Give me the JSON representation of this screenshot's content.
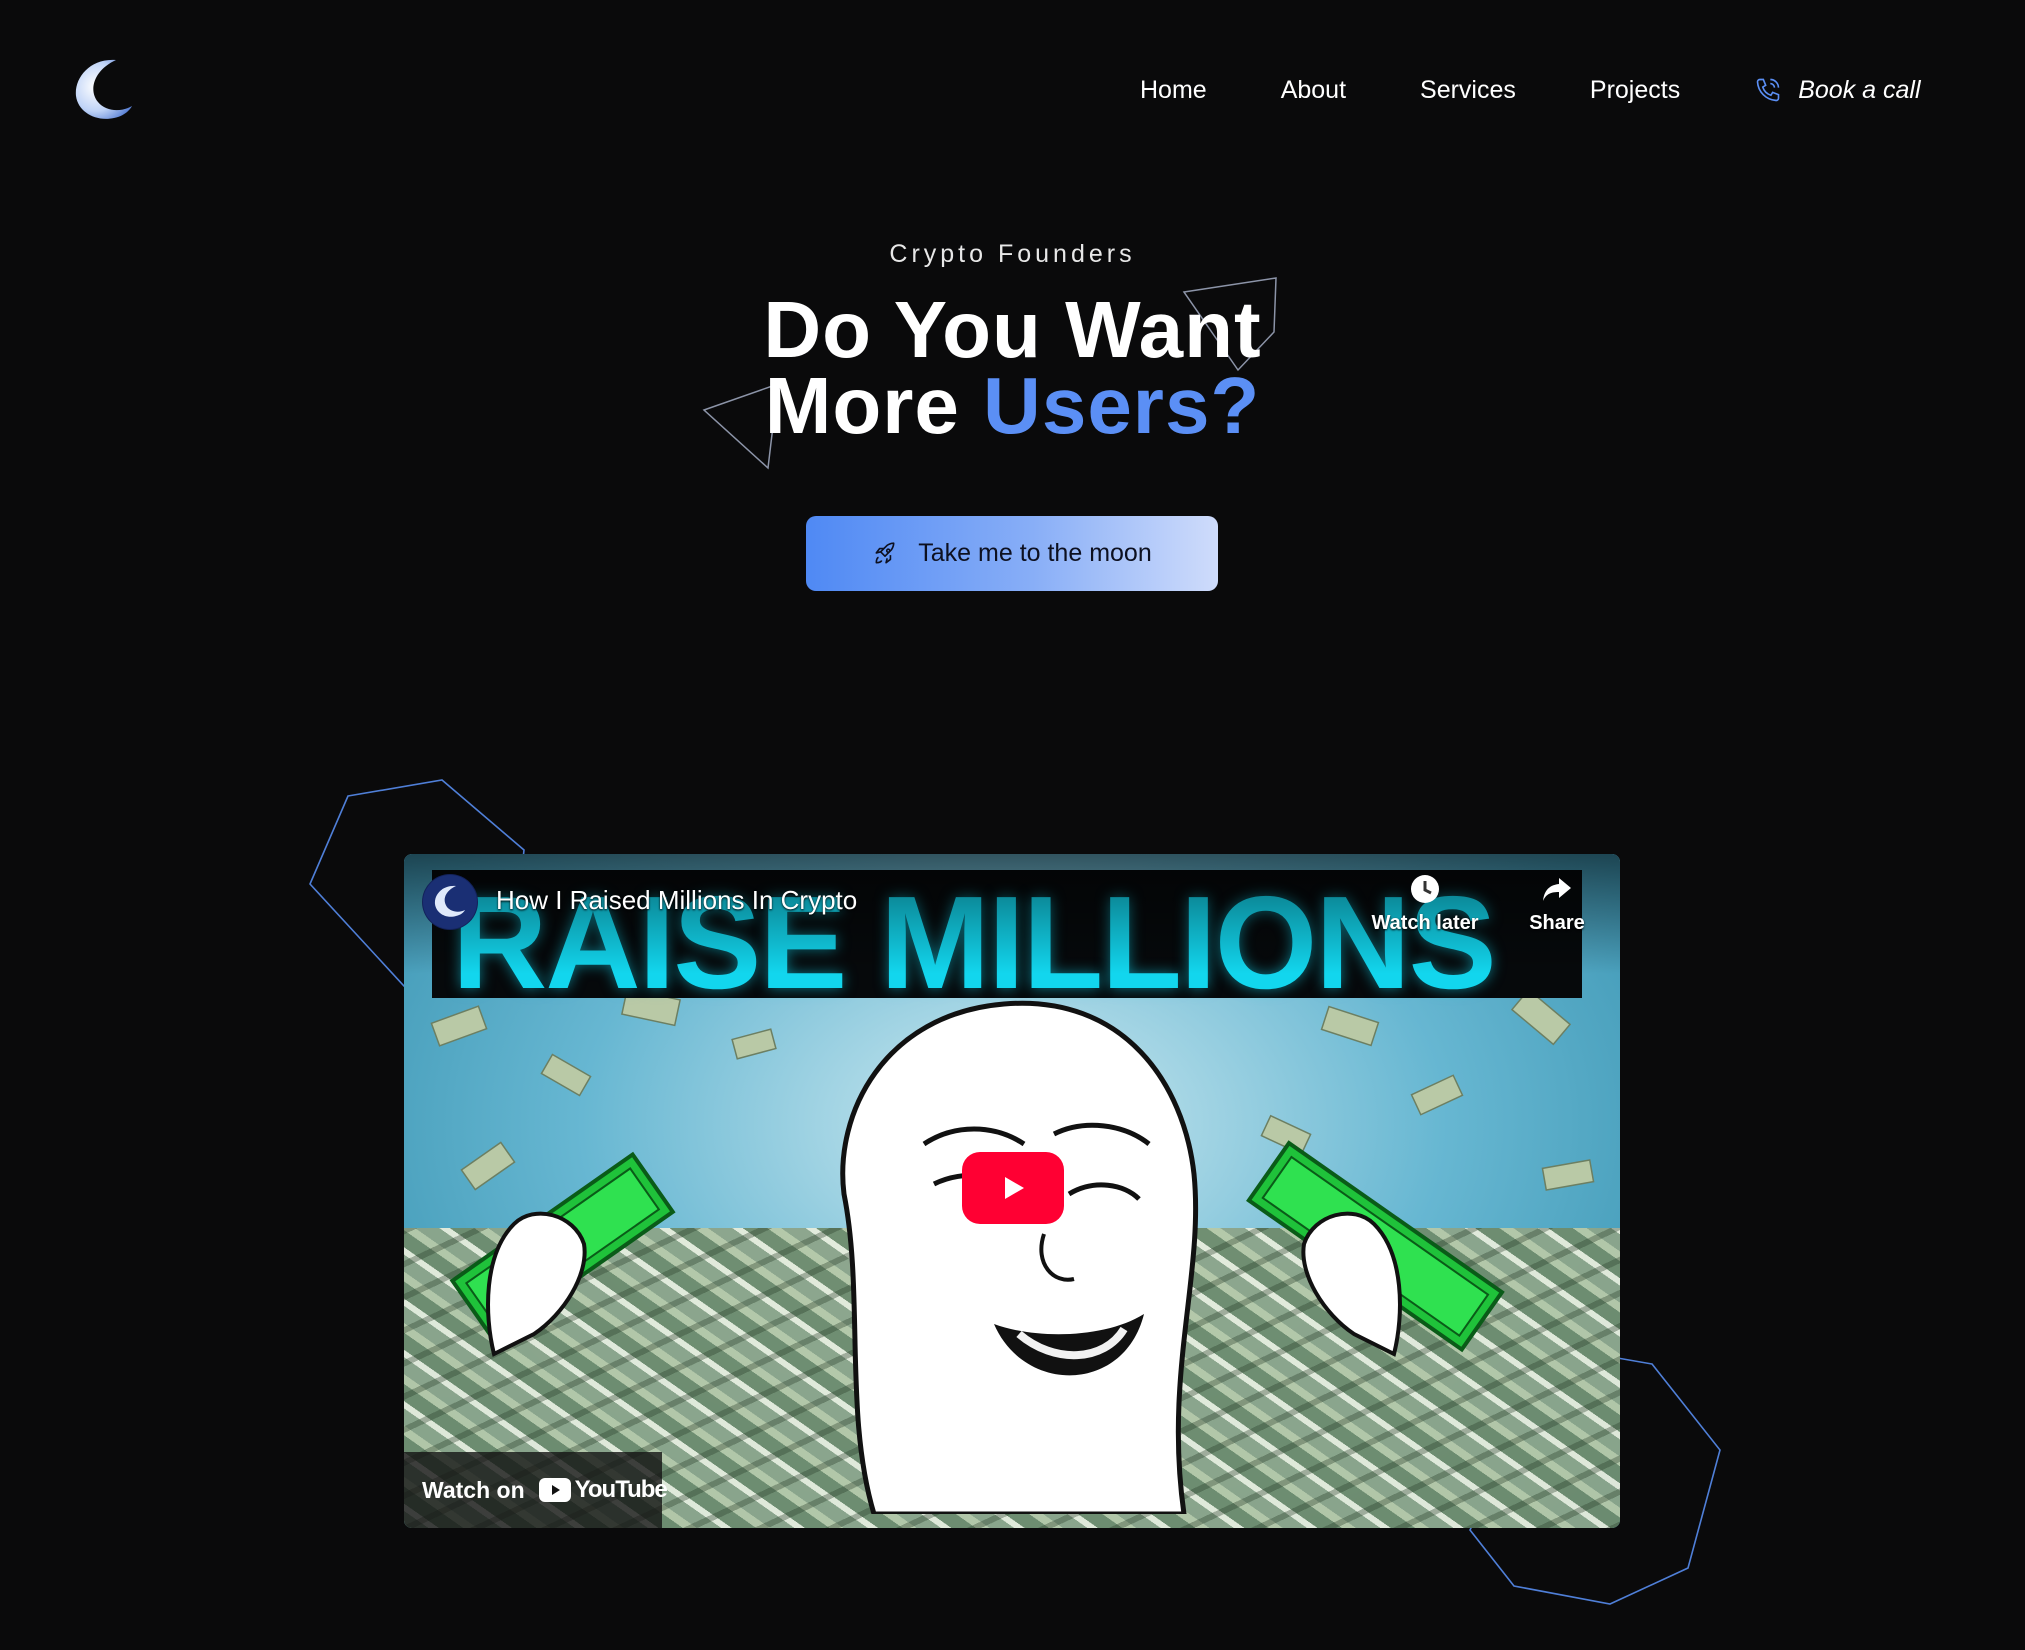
{
  "nav": {
    "items": [
      {
        "label": "Home"
      },
      {
        "label": "About"
      },
      {
        "label": "Services"
      },
      {
        "label": "Projects"
      }
    ],
    "cta_label": "Book a call"
  },
  "hero": {
    "eyebrow": "Crypto Founders",
    "headline_line1": "Do You Want",
    "headline_line2_plain": "More ",
    "headline_line2_accent": "Users?",
    "button_label": "Take me to the moon"
  },
  "video": {
    "title": "How I Raised Millions In Crypto",
    "thumbnail_text": "RAISE MILLIONS",
    "watch_later": "Watch later",
    "share": "Share",
    "watch_on": "Watch on",
    "youtube_wordmark": "YouTube"
  },
  "colors": {
    "background": "#0a0a0b",
    "accent": "#5b8ff5",
    "thumbnail_cyan": "#12d6ee",
    "youtube_red": "#ff0033"
  }
}
